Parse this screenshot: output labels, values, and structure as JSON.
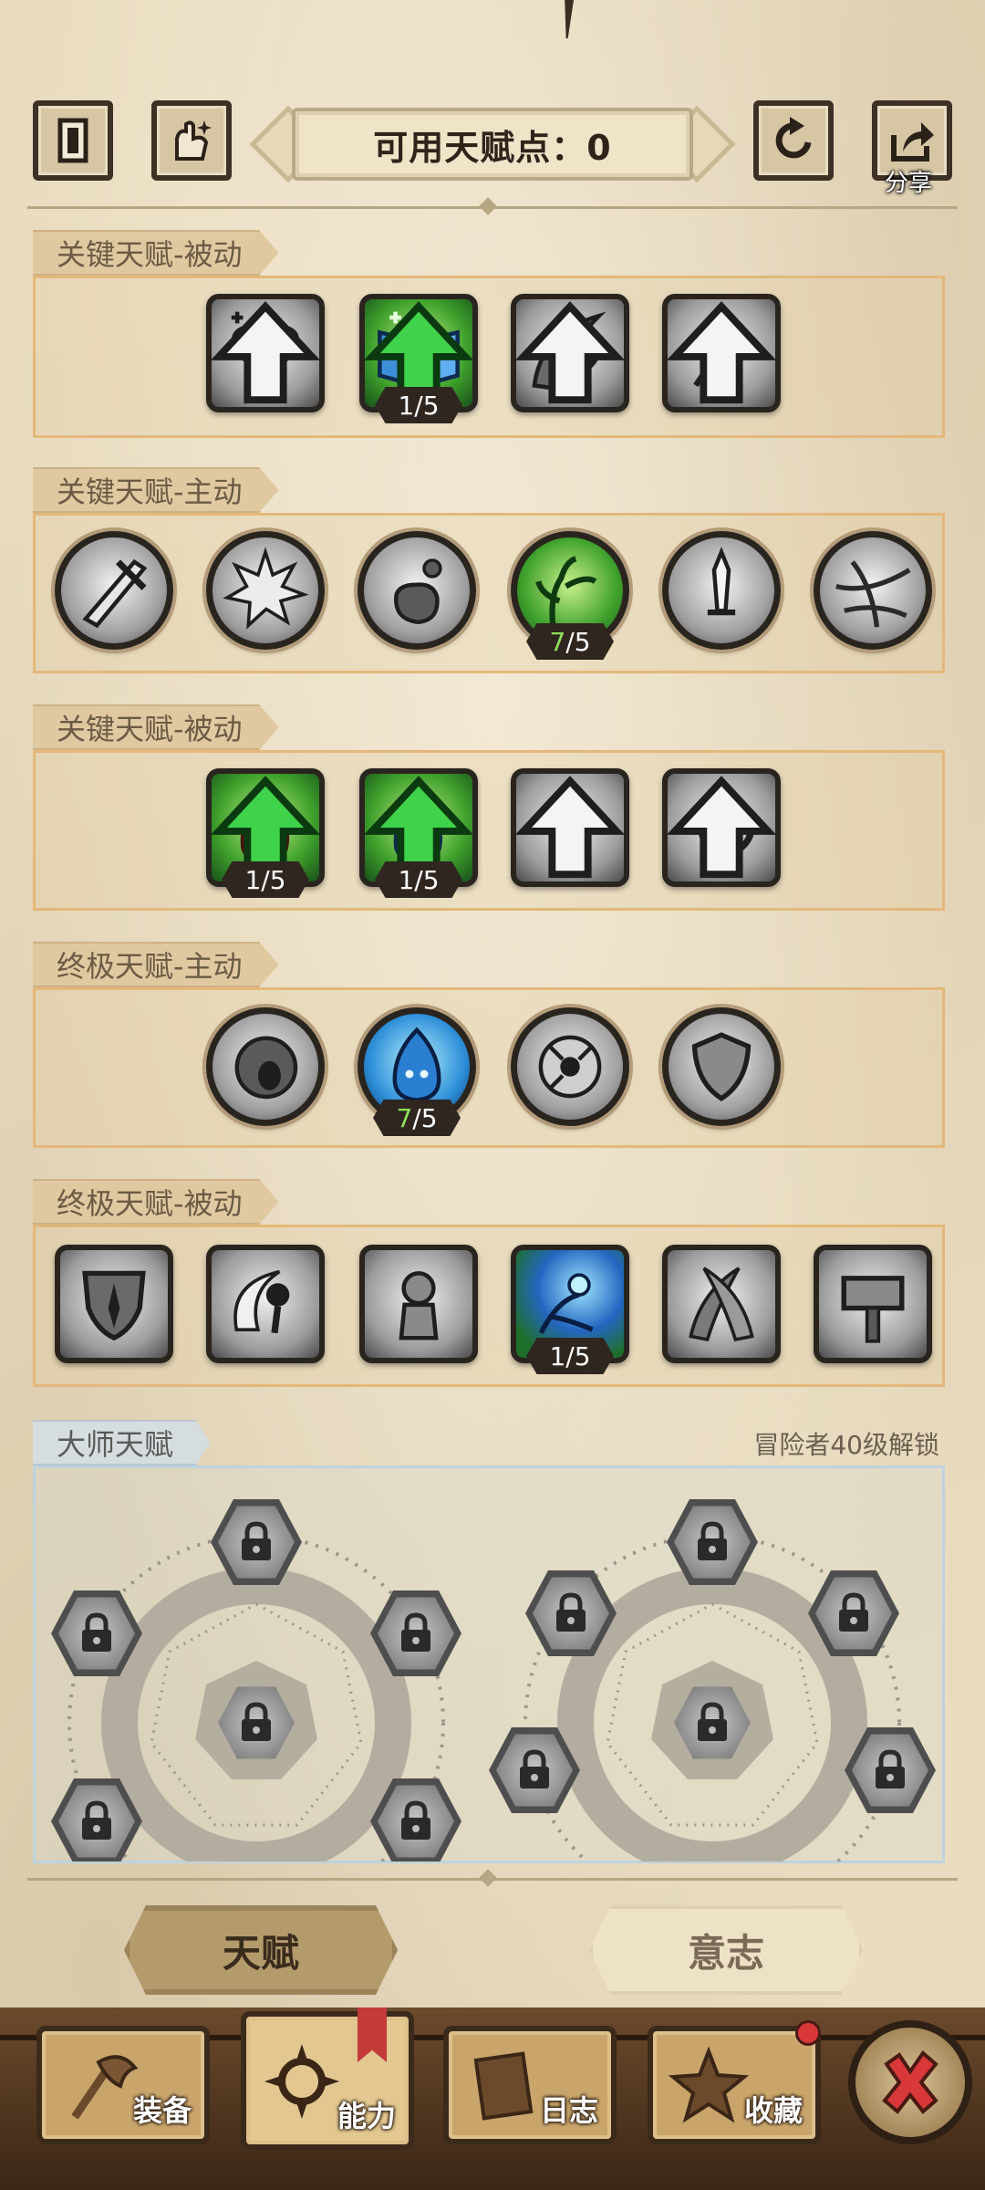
{
  "header": {
    "talent_points_label": "可用天赋点：0",
    "share_label": "分享",
    "left_btn_1_icon": "book-icon",
    "left_btn_2_icon": "hand-sparkle-icon",
    "right_btn_1_icon": "reset-icon",
    "right_btn_2_icon": "share-icon"
  },
  "sections": [
    {
      "title": "关键天赋-被动"
    },
    {
      "title": "关键天赋-主动"
    },
    {
      "title": "关键天赋-被动"
    },
    {
      "title": "终极天赋-主动"
    },
    {
      "title": "终极天赋-被动"
    }
  ],
  "levels": {
    "s1_book": "1/5",
    "s2_vine_cur": "7",
    "s2_vine_max": "/5",
    "s3_red_potion": "1/5",
    "s3_blue_potion": "1/5",
    "s4_blue_flame_cur": "7",
    "s4_blue_flame_max": "/5",
    "s5_orb": "1/5"
  },
  "master": {
    "title": "大师天赋",
    "unlock_hint": "冒险者40级解锁"
  },
  "mode_tabs": {
    "talent": "天赋",
    "will": "意志"
  },
  "nav": {
    "equipment": "装备",
    "ability": "能力",
    "log": "日志",
    "collection": "收藏"
  },
  "colors": {
    "background": "#e9dcc0",
    "section_border": "#e3b87a",
    "master_border": "#bfd2de",
    "level_badge": "#2f2620",
    "level_green": "#8fe05a",
    "close_red": "#d8383a"
  }
}
